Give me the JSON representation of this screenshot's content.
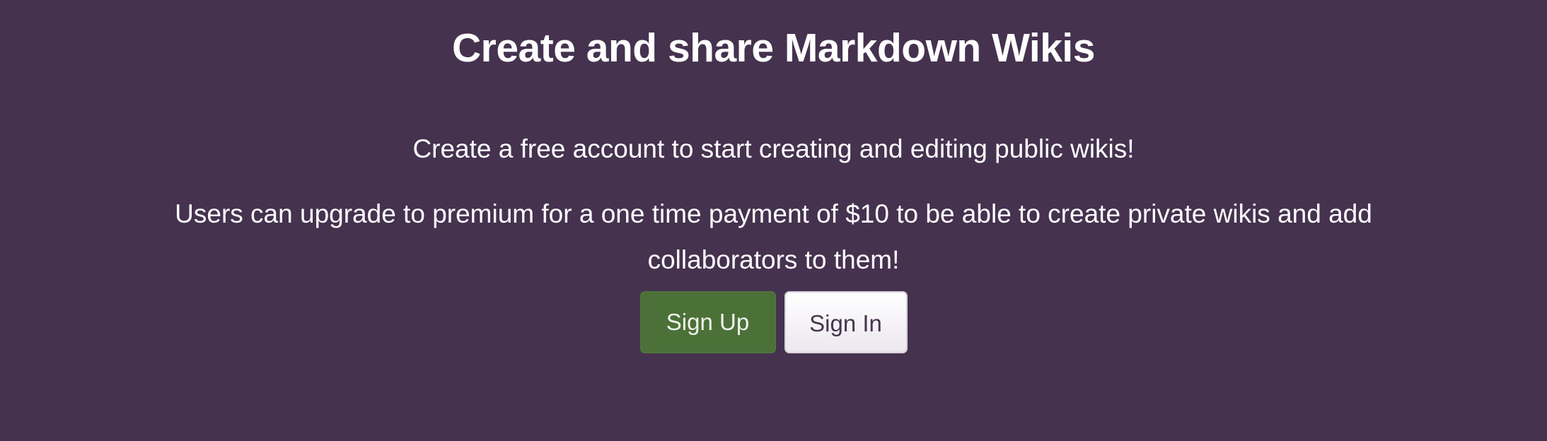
{
  "hero": {
    "title": "Create and share Markdown Wikis",
    "line1": "Create a free account to start creating and editing public wikis!",
    "line2": "Users can upgrade to premium for a one time payment of $10 to be able to create private wikis and add collaborators to them!"
  },
  "buttons": {
    "sign_up": "Sign Up",
    "sign_in": "Sign In"
  },
  "colors": {
    "background": "#45324f",
    "primary_button": "#4c7138",
    "secondary_button": "#f1eef3"
  }
}
